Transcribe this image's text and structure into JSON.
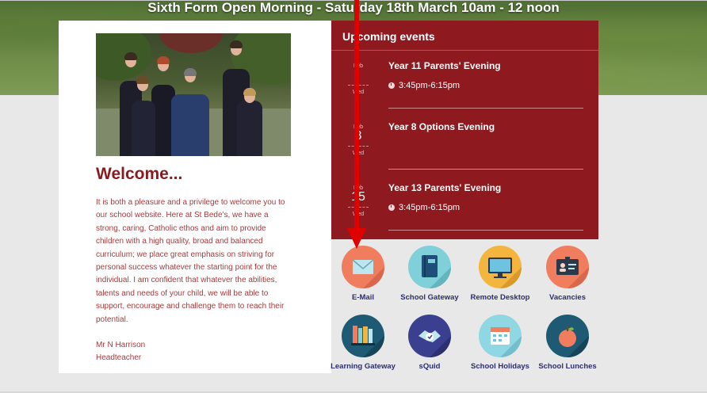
{
  "hero": {
    "banner": "Sixth Form Open Morning - Saturday 18th March 10am - 12 noon"
  },
  "welcome": {
    "title": "Welcome...",
    "paragraph": "It is both a pleasure and a privilege to welcome you to our school website. Here at St Bede's, we have a strong, caring, Catholic ethos and aim to provide children with a high quality, broad and balanced curriculum; we place great emphasis on striving for personal success whatever the starting point for the individual. I am confident that whatever the abilities, talents and needs of your child, we will be able to support, encourage and challenge them to reach their potential.",
    "signature_name": "Mr N Harrison",
    "signature_role": "Headteacher"
  },
  "events": {
    "header": "Upcoming events",
    "items": [
      {
        "month": "Feb",
        "day_num": "",
        "weekday": "Wed",
        "title": "Year 11 Parents' Evening",
        "time": "3:45pm-6:15pm"
      },
      {
        "month": "Feb",
        "day_num": "8",
        "weekday": "Wed",
        "title": "Year 8 Options Evening",
        "time": ""
      },
      {
        "month": "Feb",
        "day_num": "15",
        "weekday": "Wed",
        "title": "Year 13 Parents' Evening",
        "time": "3:45pm-6:15pm"
      }
    ]
  },
  "quicklinks": [
    {
      "label": "E-Mail",
      "icon": "envelope-icon",
      "color": "#f07d5e"
    },
    {
      "label": "School Gateway",
      "icon": "notebook-icon",
      "color": "#7fd0d9"
    },
    {
      "label": "Remote Desktop",
      "icon": "monitor-icon",
      "color": "#f4b53f"
    },
    {
      "label": "Vacancies",
      "icon": "id-card-icon",
      "color": "#f07d5e"
    },
    {
      "label": "Learning Gateway",
      "icon": "books-icon",
      "color": "#1e5a73"
    },
    {
      "label": "sQuid",
      "icon": "handshake-icon",
      "color": "#3b3f8f"
    },
    {
      "label": "School Holidays",
      "icon": "calendar-icon",
      "color": "#8fd8e3"
    },
    {
      "label": "School Lunches",
      "icon": "apple-icon",
      "color": "#1e5a73"
    }
  ],
  "colors": {
    "brand_red": "#8e1a1f",
    "annotation_arrow": "#e00000",
    "link_text": "#2d2d6b"
  }
}
